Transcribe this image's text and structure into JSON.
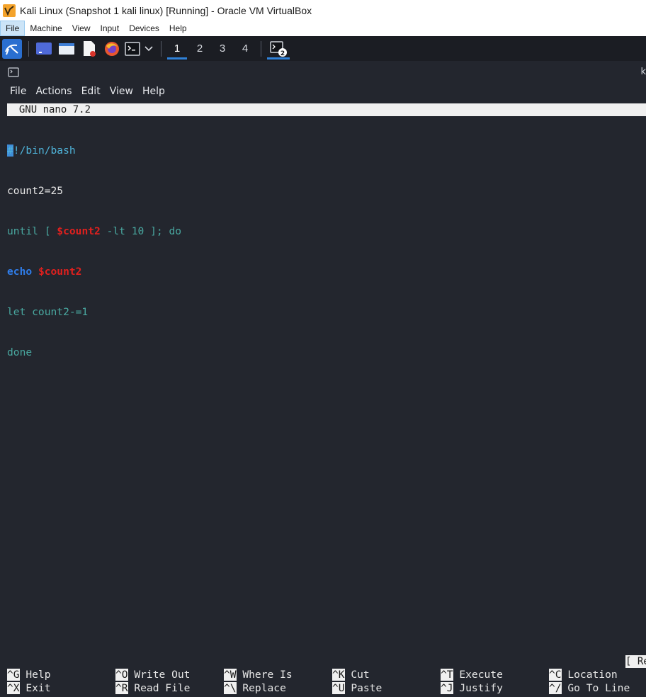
{
  "host": {
    "title": "Kali Linux (Snapshot 1 kali linux) [Running] - Oracle VM VirtualBox",
    "menu": [
      "File",
      "Machine",
      "View",
      "Input",
      "Devices",
      "Help"
    ]
  },
  "panel": {
    "workspaces": [
      "1",
      "2",
      "3",
      "4"
    ],
    "active_workspace": "1",
    "task_badge": "2"
  },
  "terminal": {
    "title_fragment": "k",
    "menu": [
      "File",
      "Actions",
      "Edit",
      "View",
      "Help"
    ]
  },
  "nano": {
    "header": "  GNU nano 7.2",
    "status_fragment": "[ Re",
    "code_lines": [
      [
        "#!/bin/bash"
      ],
      [
        "count2=25"
      ],
      [
        "until [ ",
        "$count2",
        " -lt 10 ]; do"
      ],
      [
        "echo",
        " ",
        "$count2"
      ],
      [
        "let count2-=1"
      ],
      [
        "done"
      ]
    ],
    "shortcuts_row1": [
      {
        "key": "^G",
        "label": " Help"
      },
      {
        "key": "^O",
        "label": " Write Out"
      },
      {
        "key": "^W",
        "label": " Where Is"
      },
      {
        "key": "^K",
        "label": " Cut"
      },
      {
        "key": "^T",
        "label": " Execute"
      },
      {
        "key": "^C",
        "label": " Location"
      }
    ],
    "shortcuts_row2": [
      {
        "key": "^X",
        "label": " Exit"
      },
      {
        "key": "^R",
        "label": " Read File"
      },
      {
        "key": "^\\",
        "label": " Replace"
      },
      {
        "key": "^U",
        "label": " Paste"
      },
      {
        "key": "^J",
        "label": " Justify"
      },
      {
        "key": "^/",
        "label": " Go To Line"
      }
    ]
  },
  "colors": {
    "terminal_bg": "#23262e",
    "panel_bg": "#1b1d23",
    "accent_blue": "#2f81d8",
    "variable_red": "#e0201e",
    "keyword_blue": "#2f7dea",
    "comment_cyan": "#4fb3d9",
    "statement_green": "#49a8a0"
  }
}
